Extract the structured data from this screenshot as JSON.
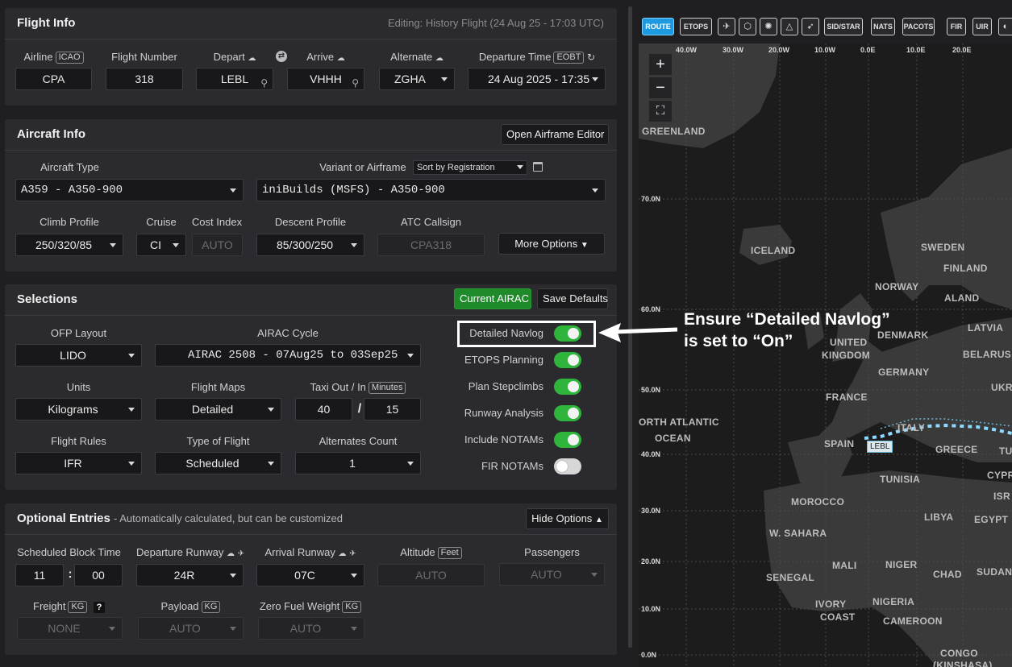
{
  "flight_info": {
    "title": "Flight Info",
    "editing_note": "Editing: History Flight (24 Aug 25 - 17:03 UTC)",
    "airline_label": "Airline",
    "airline_tag": "ICAO",
    "airline_value": "CPA",
    "flight_number_label": "Flight Number",
    "flight_number_value": "318",
    "depart_label": "Depart",
    "depart_value": "LEBL",
    "arrive_label": "Arrive",
    "arrive_value": "VHHH",
    "alternate_label": "Alternate",
    "alternate_value": "ZGHA",
    "departure_time_label": "Departure Time",
    "departure_time_tag": "EOBT",
    "departure_time_value": "24 Aug 2025 - 17:35"
  },
  "aircraft_info": {
    "title": "Aircraft Info",
    "open_airframe_editor": "Open Airframe Editor",
    "aircraft_type_label": "Aircraft Type",
    "aircraft_type_value": "A359 - A350-900",
    "variant_label": "Variant or Airframe",
    "sort_value": "Sort by Registration",
    "variant_value": "iniBuilds (MSFS) - A350-900",
    "climb_profile_label": "Climb Profile",
    "climb_profile_value": "250/320/85",
    "cruise_label": "Cruise",
    "cruise_value": "CI",
    "cost_index_label": "Cost Index",
    "cost_index_value": "AUTO",
    "descent_profile_label": "Descent Profile",
    "descent_profile_value": "85/300/250",
    "atc_callsign_label": "ATC Callsign",
    "atc_callsign_value": "CPA318",
    "more_options": "More Options"
  },
  "selections": {
    "title": "Selections",
    "current_airac": "Current AIRAC",
    "save_defaults": "Save Defaults",
    "ofp_layout_label": "OFP Layout",
    "ofp_layout_value": "LIDO",
    "airac_cycle_label": "AIRAC Cycle",
    "airac_cycle_value": "AIRAC 2508 - 07Aug25 to 03Sep25",
    "units_label": "Units",
    "units_value": "Kilograms",
    "flight_maps_label": "Flight Maps",
    "flight_maps_value": "Detailed",
    "taxi_label": "Taxi Out / In",
    "taxi_tag": "Minutes",
    "taxi_out": "40",
    "taxi_sep": "/",
    "taxi_in": "15",
    "flight_rules_label": "Flight Rules",
    "flight_rules_value": "IFR",
    "type_of_flight_label": "Type of Flight",
    "type_of_flight_value": "Scheduled",
    "alternates_count_label": "Alternates Count",
    "alternates_count_value": "1",
    "toggles": [
      {
        "label": "Detailed Navlog",
        "on": true
      },
      {
        "label": "ETOPS Planning",
        "on": true
      },
      {
        "label": "Plan Stepclimbs",
        "on": true
      },
      {
        "label": "Runway Analysis",
        "on": true
      },
      {
        "label": "Include NOTAMs",
        "on": true
      },
      {
        "label": "FIR NOTAMs",
        "on": false
      }
    ]
  },
  "optional_entries": {
    "title": "Optional Entries",
    "subtitle": "- Automatically calculated, but can be customized",
    "hide_options": "Hide Options",
    "block_time_label": "Scheduled Block Time",
    "block_hours": "11",
    "block_sep": ":",
    "block_minutes": "00",
    "dep_runway_label": "Departure Runway",
    "dep_runway_value": "24R",
    "arr_runway_label": "Arrival Runway",
    "arr_runway_value": "07C",
    "altitude_label": "Altitude",
    "altitude_tag": "Feet",
    "altitude_value": "AUTO",
    "passengers_label": "Passengers",
    "passengers_value": "AUTO",
    "freight_label": "Freight",
    "freight_tag": "KG",
    "freight_help": "?",
    "freight_value": "NONE",
    "payload_label": "Payload",
    "payload_tag": "KG",
    "payload_value": "AUTO",
    "zfw_label": "Zero Fuel Weight",
    "zfw_tag": "KG",
    "zfw_value": "AUTO"
  },
  "map": {
    "toolbar": [
      "ROUTE",
      "ETOPS",
      "SID/STAR",
      "NATS",
      "PACOTS",
      "FIR",
      "UIR"
    ],
    "zoom_in": "+",
    "zoom_out": "−",
    "lon_labels": [
      "40.0W",
      "30.0W",
      "20.0W",
      "10.0W",
      "0.0E",
      "10.0E",
      "20.0E"
    ],
    "lat_labels": [
      "70.0N",
      "60.0N",
      "50.0N",
      "40.0N",
      "30.0N",
      "20.0N",
      "10.0N",
      "0.0N"
    ],
    "countries": [
      "GREENLAND",
      "ICELAND",
      "SWEDEN",
      "FINLAND",
      "NORWAY",
      "ALAND",
      "DENMARK",
      "LATVIA",
      "UNITED",
      "KINGDOM",
      "BELARUS",
      "GERMANY",
      "FRANCE",
      "UKRAI",
      "ORTH ATLANTIC",
      "OCEAN",
      "ITALY",
      "SPAIN",
      "GREECE",
      "TU",
      "TUNISIA",
      "CYPR",
      "MOROCCO",
      "ISR",
      "LIBYA",
      "EGYPT",
      "W. SAHARA",
      "MALI",
      "NIGER",
      "CHAD",
      "SUDAN",
      "SENEGAL",
      "IVORY",
      "COAST",
      "NIGERIA",
      "CAMEROON",
      "CONGO",
      "(KINSHASA)"
    ],
    "origin_label": "LEBL"
  },
  "annotation": {
    "line1": "Ensure “Detailed Navlog”",
    "line2": "is set to “On”"
  }
}
